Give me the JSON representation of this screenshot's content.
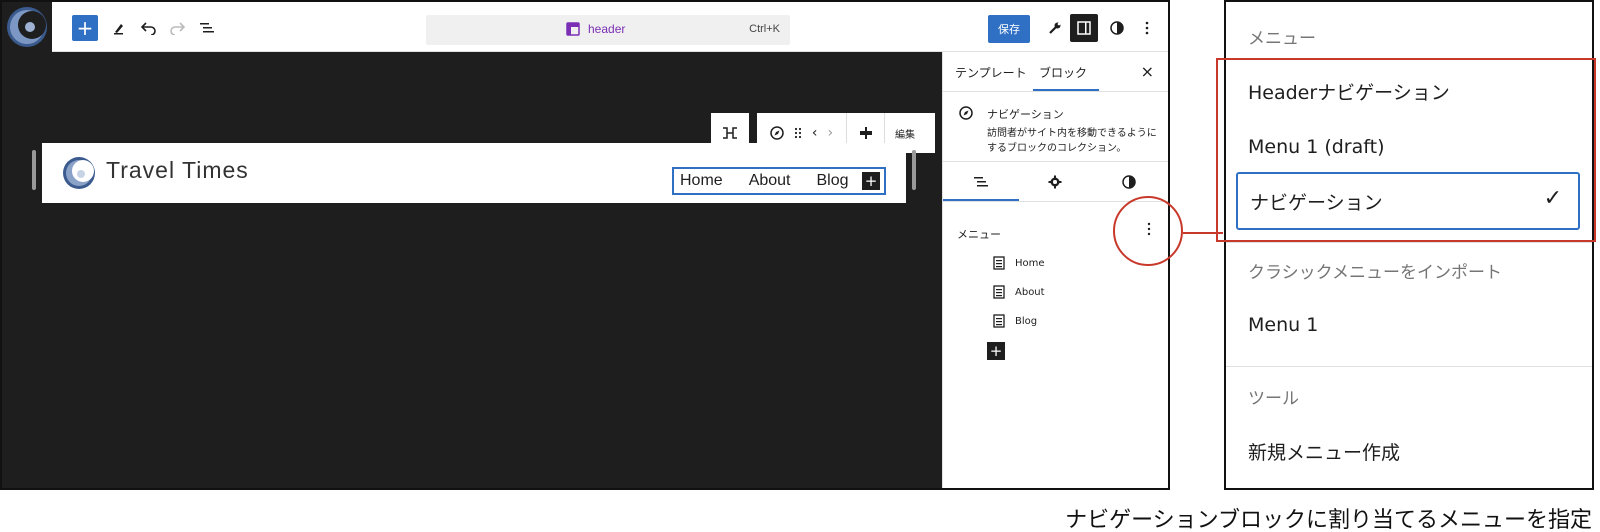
{
  "topbar": {
    "add_label": "+",
    "command": {
      "label": "header",
      "shortcut": "Ctrl+K"
    },
    "save_label": "保存"
  },
  "canvas": {
    "toolbar_edit_label": "編集",
    "site_title": "Travel Times",
    "nav_links": [
      "Home",
      "About",
      "Blog"
    ],
    "nav_add": "+"
  },
  "sidebar": {
    "tabs": [
      "テンプレート",
      "ブロック"
    ],
    "close": "×",
    "block": {
      "title": "ナビゲーション",
      "description": "訪問者がサイト内を移動できるようにするブロックのコレクション。"
    },
    "menu_heading": "メニュー",
    "menu_items": [
      "Home",
      "About",
      "Blog"
    ],
    "add": "+"
  },
  "dropdown": {
    "menus_label": "メニュー",
    "menu_options": [
      "Headerナビゲーション",
      "Menu 1 (draft)"
    ],
    "selected_option": "ナビゲーション",
    "check": "✓",
    "import_label": "クラシックメニューをインポート",
    "import_options": [
      "Menu 1"
    ],
    "tools_label": "ツール",
    "tools_options": [
      "新規メニュー作成"
    ]
  },
  "caption": "ナビゲーションブロックに割り当てるメニューを指定",
  "colors": {
    "accent": "#2f6fc4",
    "annotation": "#c8392b",
    "canvas": "#1e1e1e"
  }
}
